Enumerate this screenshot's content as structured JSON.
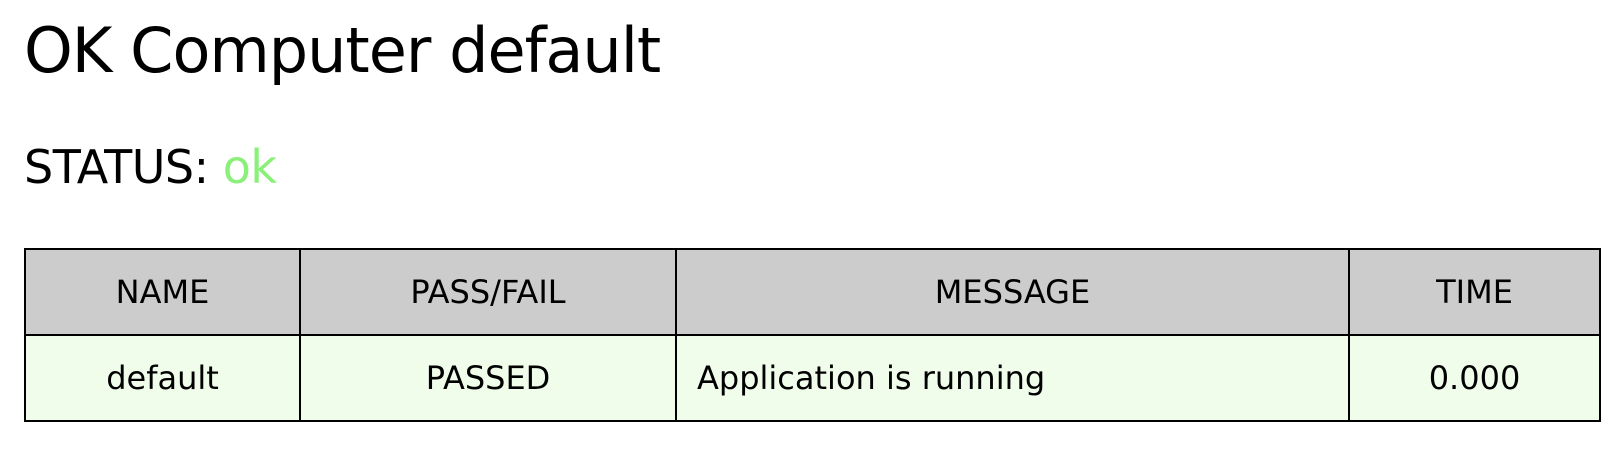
{
  "page": {
    "title": "OK Computer default"
  },
  "status": {
    "label": "STATUS:",
    "value": "ok",
    "value_color": "#8af07a"
  },
  "table": {
    "header_background": "#cccccc",
    "passed_row_background": "#f0fdeb",
    "columns": [
      "NAME",
      "PASS/FAIL",
      "MESSAGE",
      "TIME"
    ],
    "rows": [
      {
        "name": "default",
        "result": "PASSED",
        "message": "Application is running",
        "time": "0.000"
      }
    ]
  }
}
